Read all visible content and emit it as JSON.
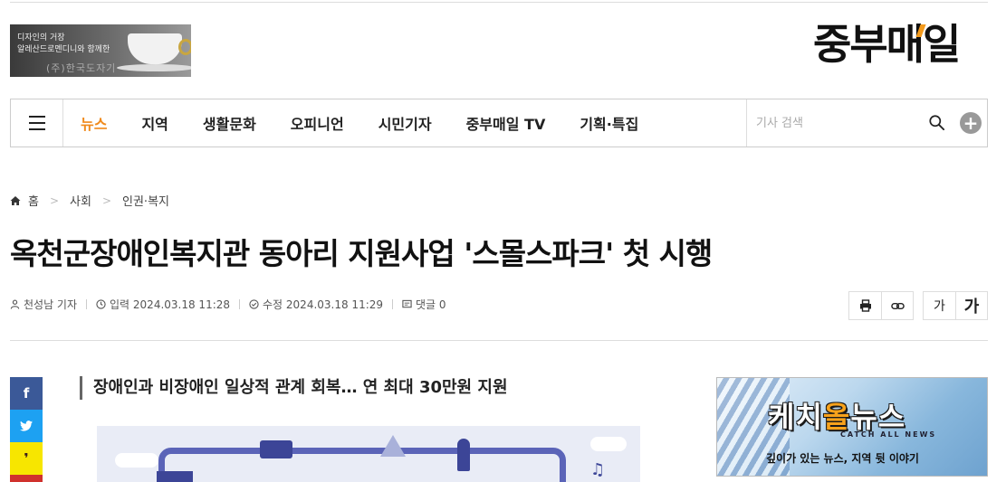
{
  "banner": {
    "line1": "디자인의 거장",
    "line2": "알레산드로멘디니와 함께한",
    "line3": "(주)한국도자기"
  },
  "logo": {
    "text": "중부매일",
    "accent_color": "#f39a1c"
  },
  "nav": {
    "items": [
      {
        "label": "뉴스",
        "active": true
      },
      {
        "label": "지역"
      },
      {
        "label": "생활문화"
      },
      {
        "label": "오피니언"
      },
      {
        "label": "시민기자"
      },
      {
        "label": "중부매일 TV"
      },
      {
        "label": "기획·특집"
      }
    ],
    "search_placeholder": "기사 검색",
    "active_color": "#f08a1c"
  },
  "breadcrumb": {
    "home": "홈",
    "level1": "사회",
    "level2": "인권·복지"
  },
  "article": {
    "title": "옥천군장애인복지관 동아리 지원사업 '스몰스파크' 첫 시행",
    "author": "천성남 기자",
    "published": "입력 2024.03.18 11:28",
    "modified": "수정 2024.03.18 11:29",
    "comments": "댓글 0",
    "subtitle": "장애인과 비장애인 일상적 관계 회복… 연 최대 30만원 지원"
  },
  "tools": {
    "font_small": "가",
    "font_large": "가"
  },
  "share": {
    "facebook": "f",
    "kakao": "❜"
  },
  "side_ad": {
    "brand_part1": "케치",
    "brand_part2": "올",
    "brand_part3": "뉴스",
    "english": "CATCH ALL NEWS",
    "tagline": "깊이가 있는 뉴스, 지역 뒷 이야기"
  }
}
